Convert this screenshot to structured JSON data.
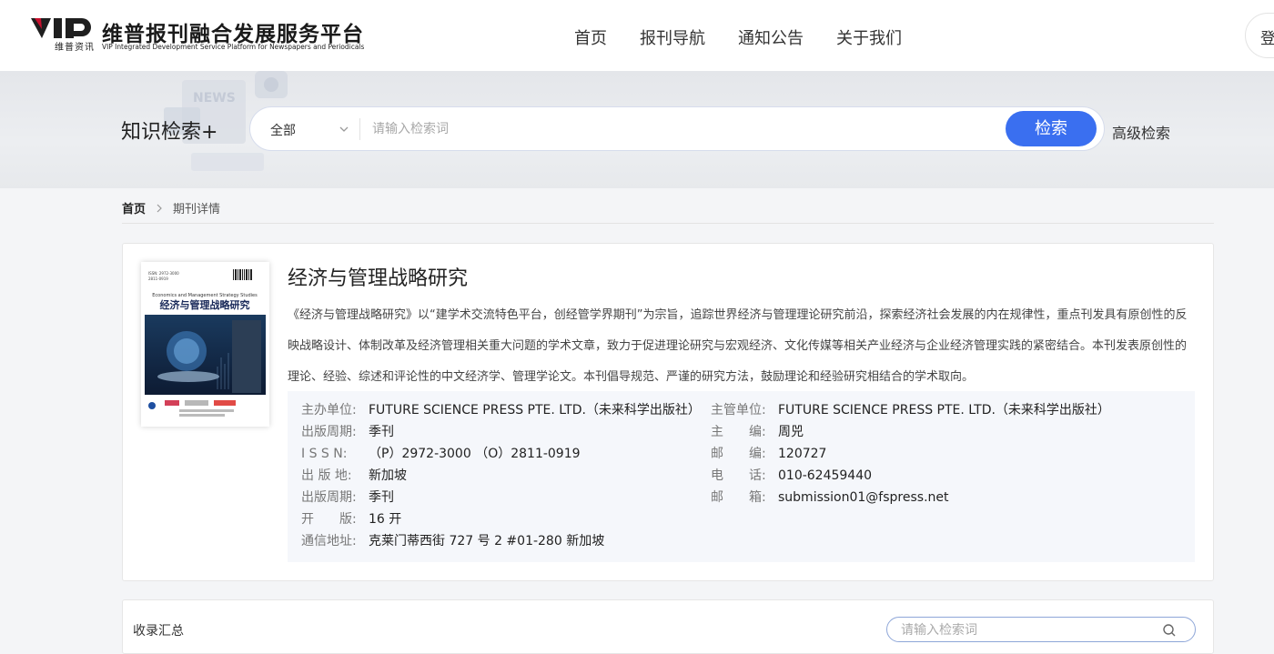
{
  "header": {
    "logo_mark_text": "VIP",
    "logo_mark_sub": "维普资讯",
    "logo_title": "维普报刊融合发展服务平台",
    "logo_subtitle": "VIP Integrated Development Service Platform for Newspapers and Periodicals",
    "nav": [
      {
        "label": "首页"
      },
      {
        "label": "报刊导航"
      },
      {
        "label": "通知公告"
      },
      {
        "label": "关于我们"
      }
    ],
    "login_label": "登"
  },
  "search": {
    "title": "知识检索+",
    "scope": "全部",
    "placeholder": "请输入检索词",
    "button": "检索",
    "advanced": "高级检索",
    "banner_deco_text": "NEWS"
  },
  "breadcrumb": {
    "home": "首页",
    "current": "期刊详情"
  },
  "journal": {
    "cover": {
      "issn_lines": [
        "ISSN: 2972-3000",
        "2811-0919"
      ],
      "en_title": "Economics and Management Strategy Studies",
      "title": "经济与管理战略研究"
    },
    "title": "经济与管理战略研究",
    "description": "《经济与管理战略研究》以“建学术交流特色平台，创经管学界期刊”为宗旨，追踪世界经济与管理理论研究前沿，探索经济社会发展的内在规律性，重点刊发具有原创性的反映战略设计、体制改革及经济管理相关重大问题的学术文章，致力于促进理论研究与宏观经济、文化传媒等相关产业经济与企业经济管理实践的紧密结合。本刊发表原创性的理论、经验、综述和评论性的中文经济学、管理学论文。本刊倡导规范、严谨的研究方法，鼓励理论和经验研究相结合的学术取向。",
    "info_left": [
      {
        "label": "主办单位:",
        "value": "FUTURE SCIENCE PRESS PTE. LTD.（未来科学出版社）"
      },
      {
        "label": "出版周期:",
        "value": "季刊"
      },
      {
        "label": "I S S N:",
        "value": "（P）2972-3000 （O）2811-0919"
      },
      {
        "label": "出 版 地:",
        "value": "新加坡"
      },
      {
        "label": "出版周期:",
        "value": "季刊"
      },
      {
        "label": "开　　版:",
        "value": "16 开"
      },
      {
        "label": "通信地址:",
        "value": "克莱门蒂西街 727 号 2 #01-280 新加坡"
      }
    ],
    "info_right": [
      {
        "label": "主管单位:",
        "value": "FUTURE SCIENCE PRESS PTE. LTD.（未来科学出版社）"
      },
      {
        "label": "主　　编:",
        "value": "周兕"
      },
      {
        "label": "邮　　编:",
        "value": "120727"
      },
      {
        "label": "电　　话:",
        "value": "010-62459440"
      },
      {
        "label": "邮　　箱:",
        "value": "submission01@fspress.net"
      }
    ]
  },
  "collection": {
    "title": "收录汇总",
    "placeholder": "请输入检索词"
  },
  "colors": {
    "accent": "#3a6ff0",
    "logo_red": "#c8102e"
  }
}
